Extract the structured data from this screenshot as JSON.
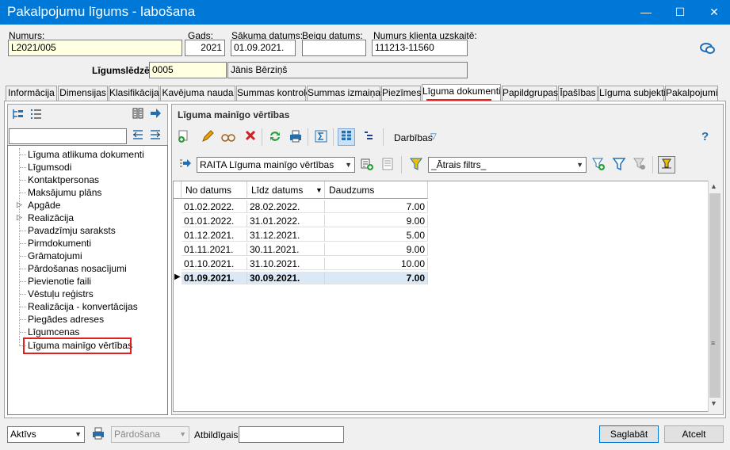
{
  "window": {
    "title": "Pakalpojumu līgums - labošana",
    "minimize": "—",
    "maximize": "☐",
    "close": "✕"
  },
  "header": {
    "numurs_label": "Numurs:",
    "numurs_value": "L2021/005",
    "gads_label": "Gads:",
    "gads_value": "2021",
    "sakuma_label": "Sākuma datums:",
    "sakuma_value": "01.09.2021.",
    "beigu_label": "Beigu datums:",
    "beigu_value": "",
    "klienta_label": "Numurs klienta uzskaitē:",
    "klienta_value": "111213-11560",
    "ligumsledzejs_label": "Līgumslēdzējs:",
    "ligumsledzejs_code": "0005",
    "ligumsledzejs_name": "Jānis Bērziņš"
  },
  "tabs": [
    "Informācija",
    "Dimensijas",
    "Klasifikācija",
    "Kavējuma nauda",
    "Summas kontrole",
    "Summas izmaiņas",
    "Piezīmes",
    "Līguma dokumenti",
    "Papildgrupas",
    "Īpašības",
    "Līguma subjekti",
    "Pakalpojumi"
  ],
  "active_tab": "Līguma dokumenti",
  "tree": {
    "search_value": "",
    "items": [
      "Līguma atlikuma dokumenti",
      "Līgumsodi",
      "Kontaktpersonas",
      "Maksājumu plāns",
      "Apgāde",
      "Realizācija",
      "Pavadzīmju saraksts",
      "Pirmdokumenti",
      "Grāmatojumi",
      "Pārdošanas nosacījumi",
      "Pievienotie faili",
      "Vēstuļu reģistrs",
      "Realizācija - konvertācijas",
      "Piegādes adreses",
      "Līgumcenas",
      "Līguma mainīgo vērtības"
    ],
    "expandable": [
      "Apgāde",
      "Realizācija"
    ],
    "selected": "Līguma mainīgo vērtības"
  },
  "panel": {
    "title": "Līguma mainīgo vērtības",
    "actions_label": "Darbības",
    "help_icon": "?",
    "layout_combo": "RAITA Līguma mainīgo vērtības",
    "filter_combo": "_Ātrais filtrs_"
  },
  "grid": {
    "columns": [
      "No datums",
      "Līdz datums",
      "Daudzums"
    ],
    "rows": [
      [
        "01.02.2022.",
        "28.02.2022.",
        "7.00"
      ],
      [
        "01.01.2022.",
        "31.01.2022.",
        "9.00"
      ],
      [
        "01.12.2021.",
        "31.12.2021.",
        "5.00"
      ],
      [
        "01.11.2021.",
        "30.11.2021.",
        "9.00"
      ],
      [
        "01.10.2021.",
        "31.10.2021.",
        "10.00"
      ],
      [
        "01.09.2021.",
        "30.09.2021.",
        "7.00"
      ]
    ],
    "selected_row": 5,
    "sort_indicator": "▼"
  },
  "footer": {
    "status_value": "Aktīvs",
    "type_value": "Pārdošana",
    "atbildigais_label": "Atbildīgais:",
    "atbildigais_value": "",
    "save_label": "Saglabāt",
    "cancel_label": "Atcelt"
  },
  "colors": {
    "titlebar": "#0078d7",
    "highlight_red": "#e02020",
    "selection_row": "#dbe8f6",
    "required_field": "#ffffe1"
  }
}
